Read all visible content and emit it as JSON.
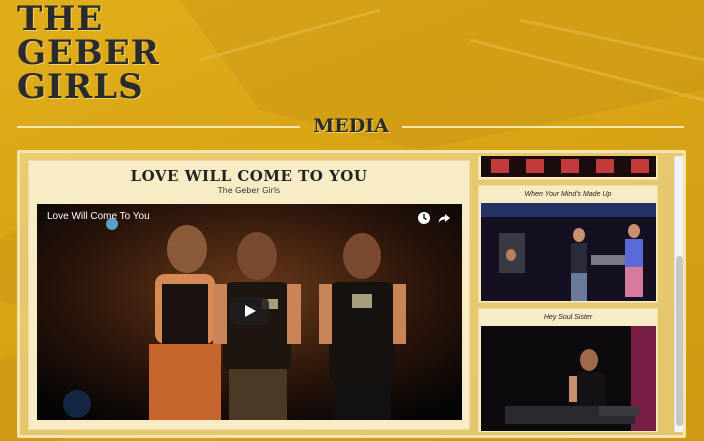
{
  "site": {
    "logo_lines": [
      "THE",
      "GEBER",
      "GIRLS"
    ]
  },
  "section": {
    "title": "MEDIA"
  },
  "featured": {
    "title": "LOVE WILL COME TO YOU",
    "subtitle": "The Geber Girls",
    "player_title": "Love Will Come To You"
  },
  "playlist": [
    {
      "label": ""
    },
    {
      "label": "When Your Mind's Made Up"
    },
    {
      "label": "Hey Soul Sister"
    }
  ],
  "icons": {
    "watch_later": "clock-icon",
    "share": "share-icon",
    "play": "play-icon"
  },
  "colors": {
    "background": "#d9a516",
    "panel": "#f8ecc6",
    "logo": "#2b2b2b"
  }
}
